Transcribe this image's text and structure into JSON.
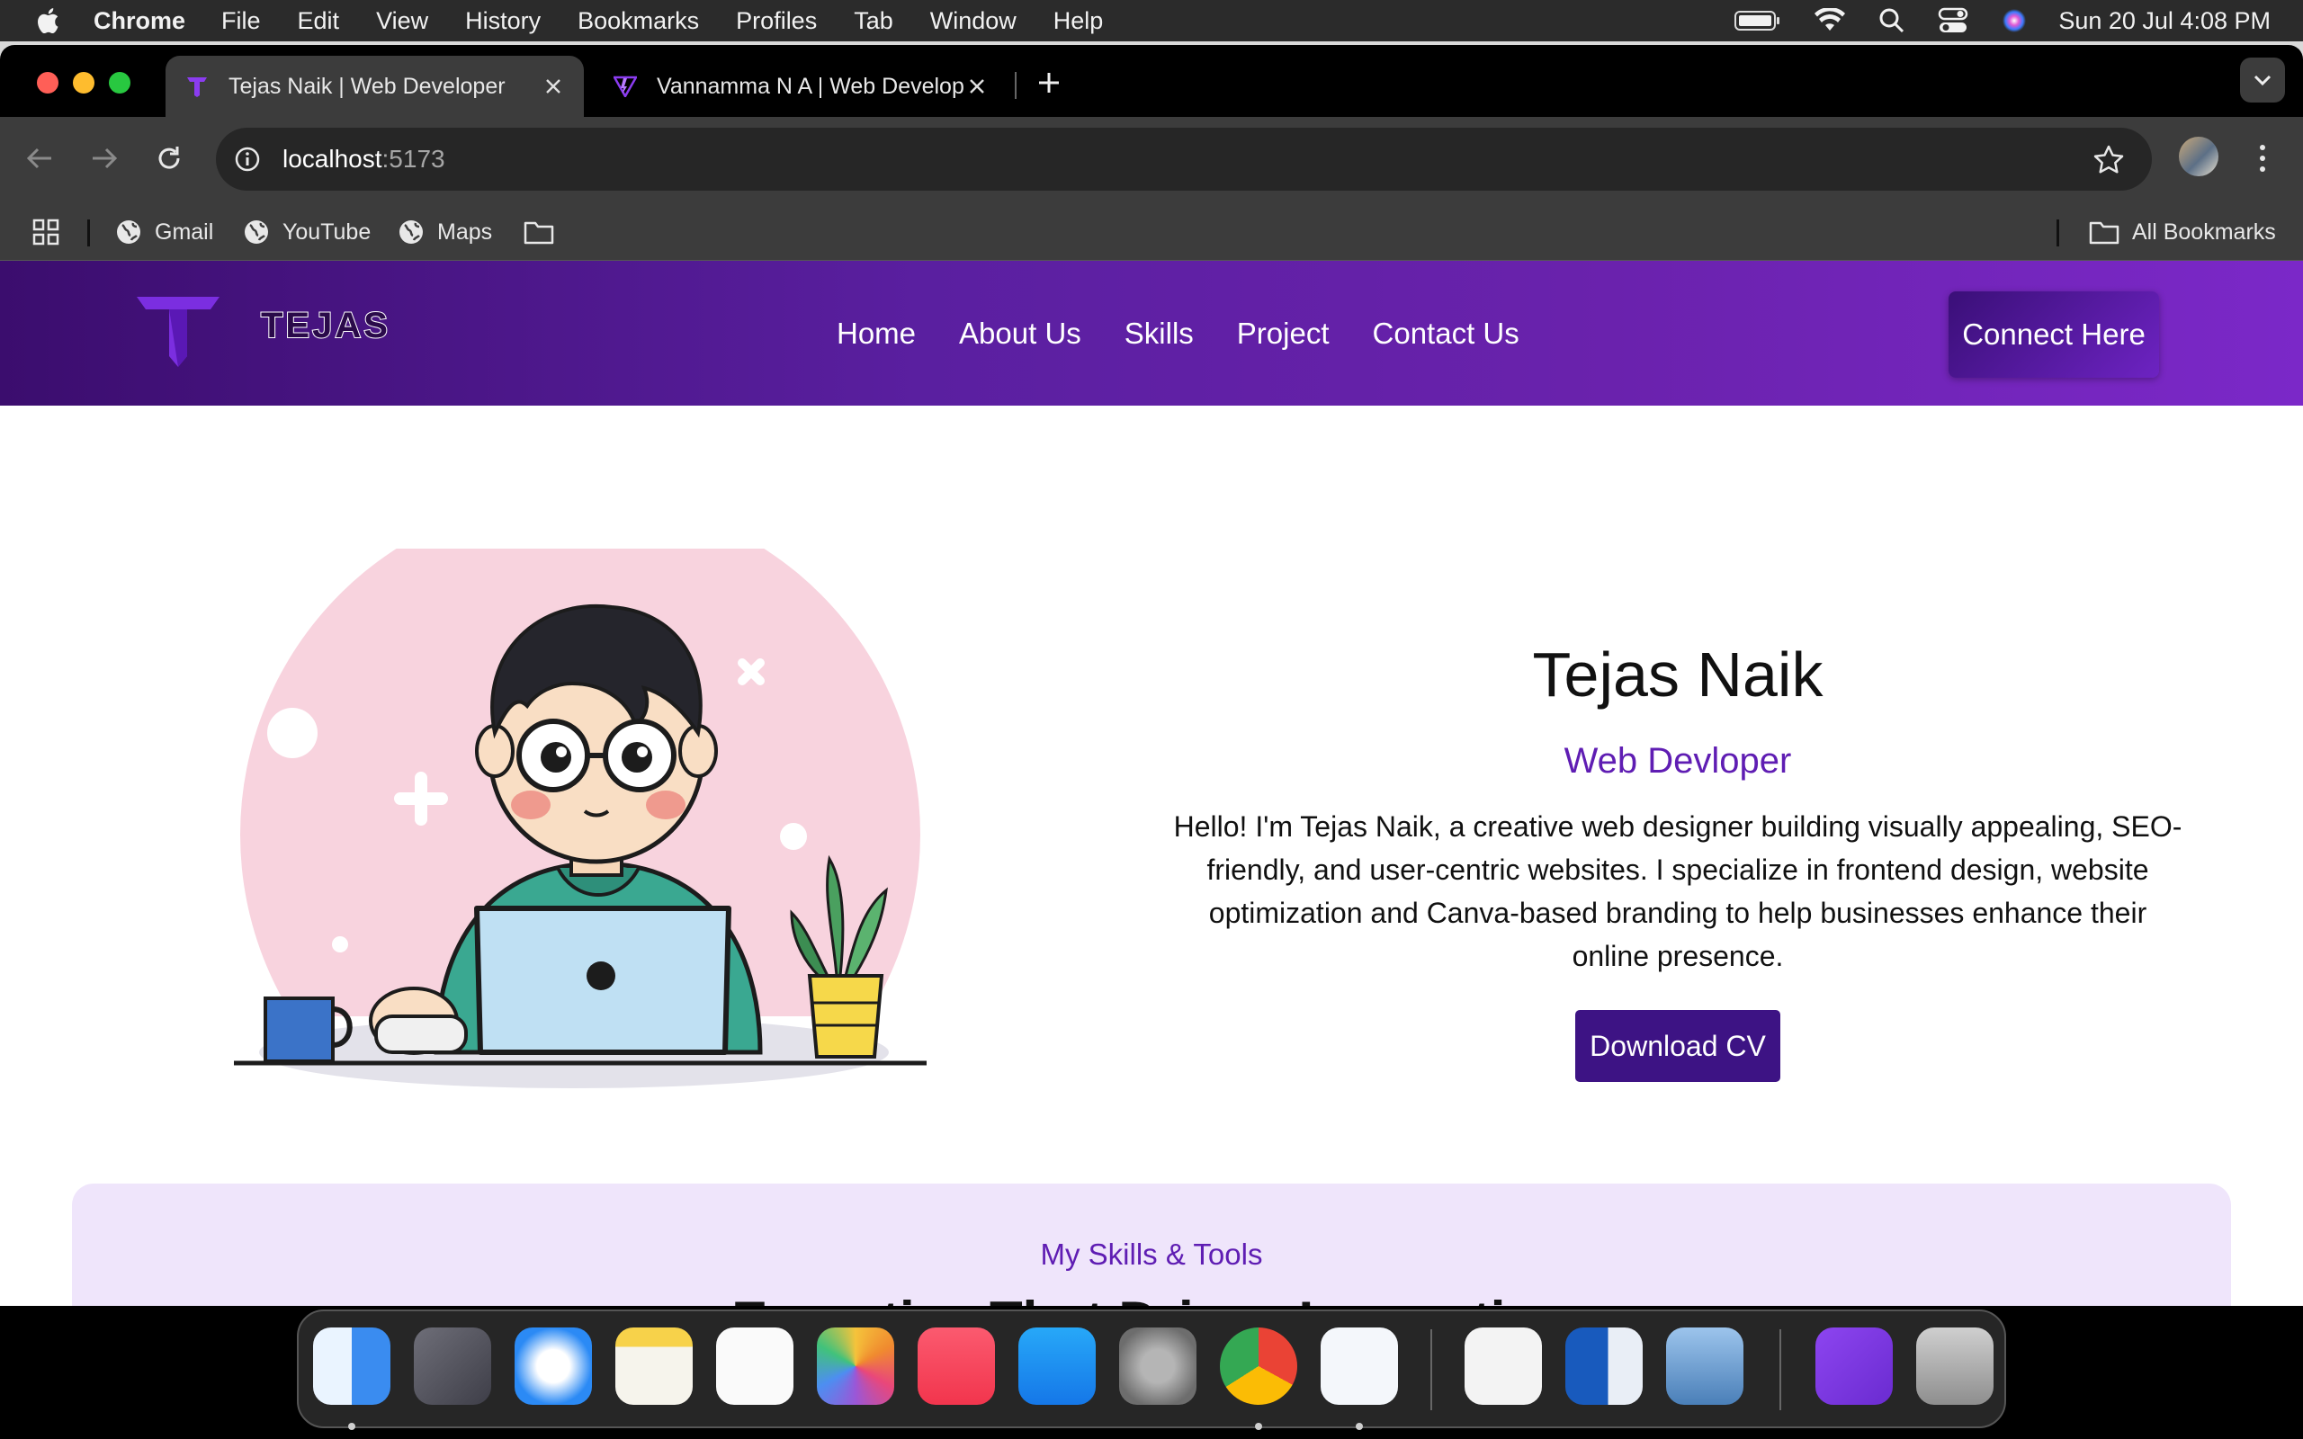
{
  "menubar": {
    "app_name": "Chrome",
    "items": [
      "File",
      "Edit",
      "View",
      "History",
      "Bookmarks",
      "Profiles",
      "Tab",
      "Window",
      "Help"
    ],
    "clock": "Sun 20 Jul  4:08 PM"
  },
  "browser": {
    "tabs": [
      {
        "title": "Tejas Naik | Web Developer",
        "active": true,
        "favicon": "tejas-logo-icon"
      },
      {
        "title": "Vannamma N A | Web Developer",
        "active": false,
        "favicon": "vite-logo-icon"
      }
    ],
    "address": {
      "host": "localhost",
      "port": ":5173"
    },
    "bookmarks": [
      {
        "label": "Gmail",
        "icon": "globe-icon"
      },
      {
        "label": "YouTube",
        "icon": "globe-icon"
      },
      {
        "label": "Maps",
        "icon": "globe-icon"
      }
    ],
    "all_bookmarks": "All Bookmarks"
  },
  "site": {
    "logo_text": "TEJAS",
    "nav": [
      "Home",
      "About Us",
      "Skills",
      "Project",
      "Contact Us"
    ],
    "connect_button": "Connect Here",
    "hero": {
      "name": "Tejas Naik",
      "role": "Web Devloper",
      "bio": "Hello! I'm Tejas Naik, a creative web designer building visually appealing, SEO-friendly, and user-centric websites. I specialize in frontend design, website optimization and Canva-based branding to help businesses enhance their online presence.",
      "cv_button": "Download CV"
    },
    "skills": {
      "subtitle": "My Skills & Tools",
      "title": "Expertise That Drives Innovation"
    },
    "colors": {
      "brand_purple": "#5f1db3",
      "nav_dark": "#3b0d6e",
      "button_dark": "#3d1384",
      "skills_bg": "#efe5fb"
    }
  },
  "dock": {
    "apps": [
      "Finder",
      "Launchpad",
      "Safari",
      "Notes",
      "Reminders",
      "Photos",
      "Music",
      "App Store",
      "System Settings",
      "Google Chrome",
      "Visual Studio Code",
      "System Information",
      "Microsoft Word",
      "Preview",
      "Bootstrap Studio",
      "Trash"
    ]
  }
}
